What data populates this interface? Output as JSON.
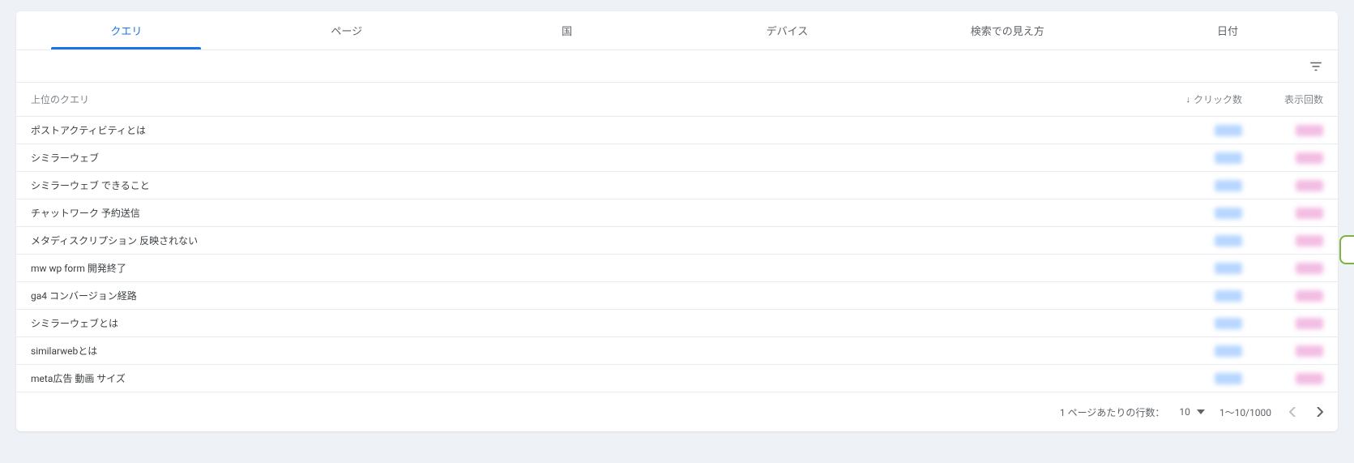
{
  "tabs": {
    "query": "クエリ",
    "page": "ページ",
    "country": "国",
    "device": "デバイス",
    "appearance": "検索での見え方",
    "date": "日付"
  },
  "headers": {
    "query_col": "上位のクエリ",
    "clicks_col": "クリック数",
    "impressions_col": "表示回数"
  },
  "rows": [
    {
      "q": "ポストアクティビティとは"
    },
    {
      "q": "シミラーウェブ"
    },
    {
      "q": "シミラーウェブ できること"
    },
    {
      "q": "チャットワーク 予約送信"
    },
    {
      "q": "メタディスクリプション 反映されない"
    },
    {
      "q": "mw wp form 開発終了"
    },
    {
      "q": "ga4 コンバージョン経路"
    },
    {
      "q": "シミラーウェブとは"
    },
    {
      "q": "similarwebとは"
    },
    {
      "q": "meta広告 動画 サイズ"
    }
  ],
  "footer": {
    "rows_per_page_label": "1 ページあたりの行数：",
    "rows_per_page_value": "10",
    "range": "1～10/1000"
  }
}
